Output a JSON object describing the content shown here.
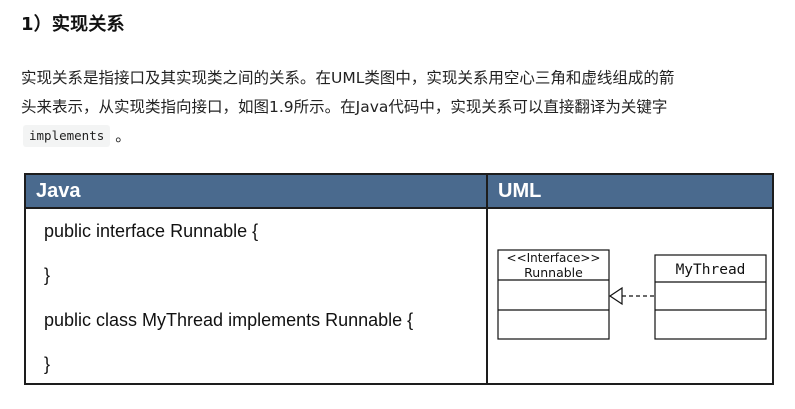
{
  "heading": "1）实现关系",
  "paragraph": {
    "line1": "实现关系是指接口及其实现类之间的关系。在UML类图中，实现关系用空心三角和虚线组成的箭",
    "line2": "头来表示，从实现类指向接口，如图1.9所示。在Java代码中，实现关系可以直接翻译为关键字",
    "code": "implements",
    "end": "。"
  },
  "figure": {
    "col_java": "Java",
    "col_uml": "UML",
    "code_lines": [
      "public interface Runnable {",
      "}",
      "public class MyThread implements Runnable {",
      "}"
    ],
    "uml": {
      "interface_stereotype": "<<Interface>>",
      "interface_name": "Runnable",
      "class_name": "MyThread"
    }
  }
}
